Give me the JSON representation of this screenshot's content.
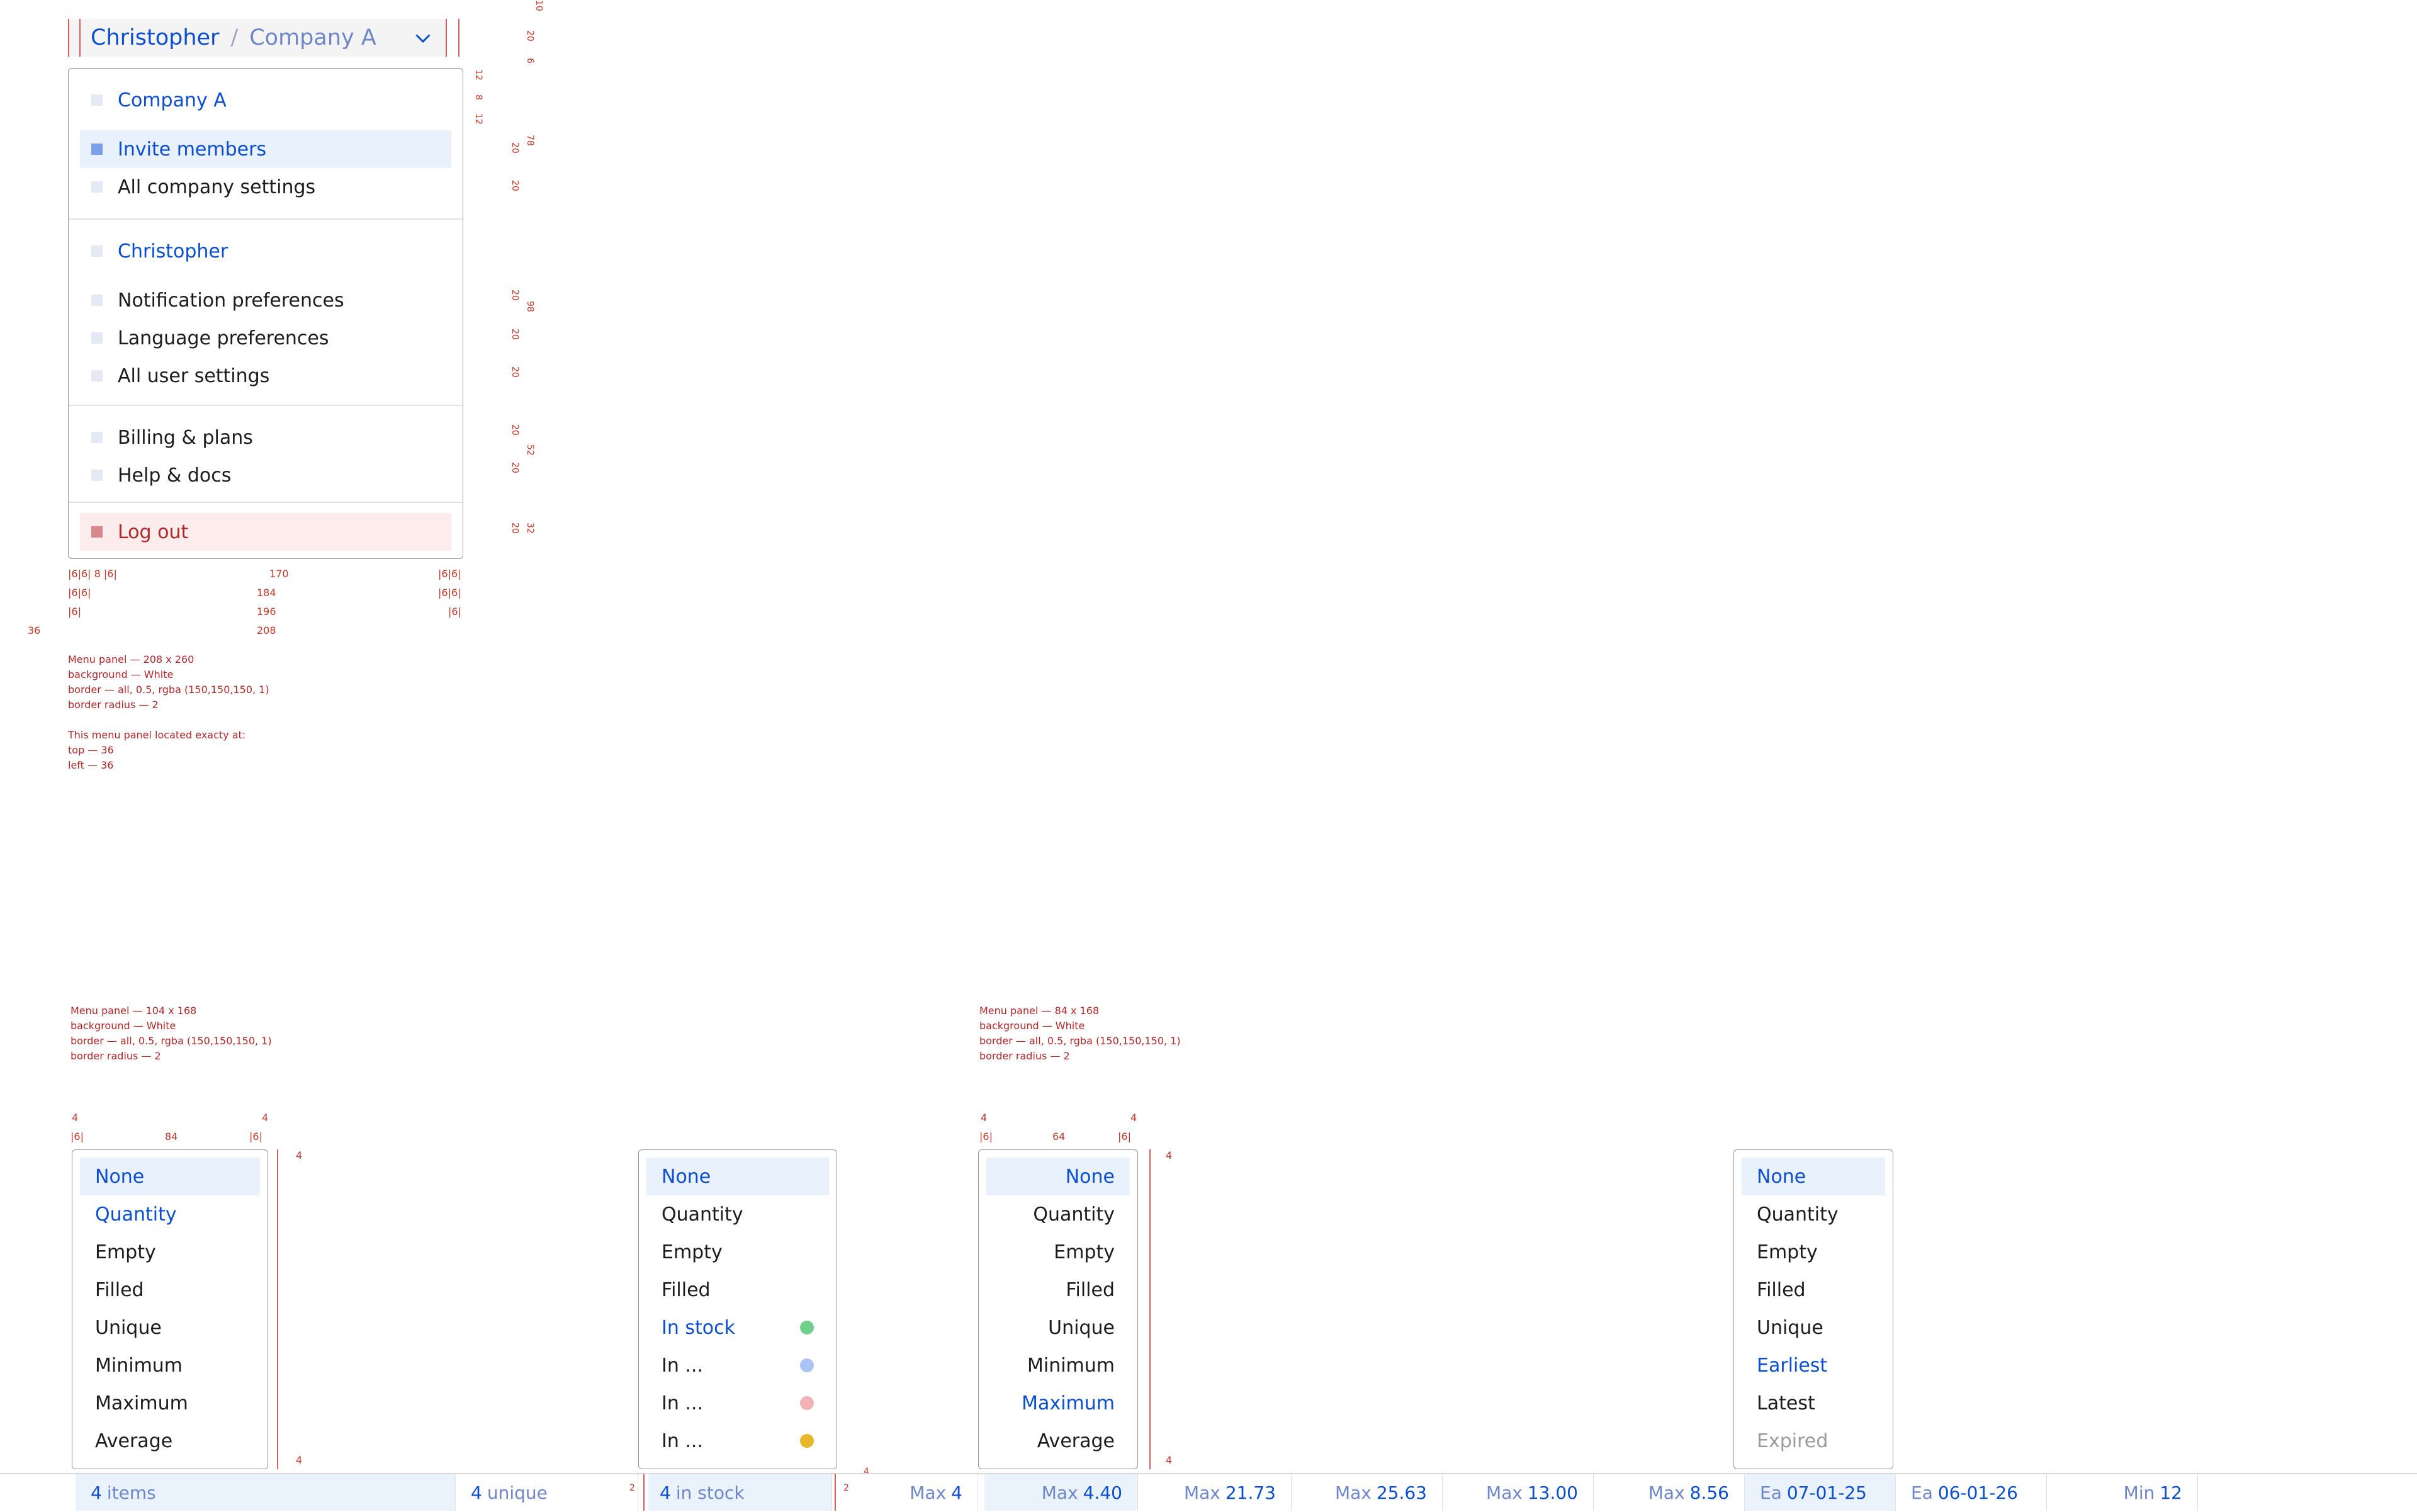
{
  "account": {
    "name": "Christopher",
    "separator": "/",
    "company": "Company A"
  },
  "menu": {
    "company_header": "Company A",
    "invite": "Invite members",
    "company_settings": "All company settings",
    "user_header": "Christopher",
    "notifications": "Notification preferences",
    "language": "Language preferences",
    "user_settings": "All user settings",
    "billing": "Billing & plans",
    "help": "Help & docs",
    "logout": "Log out"
  },
  "annotations": {
    "panel1": [
      "Menu panel — 208 x 260",
      "background — White",
      "border — all, 0.5, rgba (150,150,150, 1)",
      "border radius — 2",
      "",
      "This menu panel located exacty at:",
      "top — 36",
      "left — 36"
    ],
    "panel2": [
      "Menu panel — 104 x 168",
      "background — White",
      "border — all, 0.5, rgba (150,150,150, 1)",
      "border radius — 2"
    ],
    "panel3": [
      "Menu panel — 84 x 168",
      "background — White",
      "border — all, 0.5, rgba (150,150,150, 1)",
      "border radius — 2"
    ],
    "widths_main": [
      "|6|6| 8 |6|",
      "170",
      "|6|6|",
      "|6|6|",
      "184",
      "|6|6|",
      "|6|",
      "196",
      "|6|",
      "208",
      "36"
    ],
    "heights_right": [
      "10",
      "20",
      "6",
      "12",
      "8",
      "12",
      "78",
      "20",
      "20",
      "98",
      "20",
      "20",
      "20",
      "52",
      "20",
      "20",
      "32",
      "20"
    ],
    "small_widths": [
      "4",
      "|6|",
      "84",
      "|6|",
      "4",
      "4",
      "|6|",
      "64",
      "|6|",
      "4"
    ],
    "small_heights": [
      "4",
      "4",
      "4",
      "4",
      "2",
      "2",
      "4"
    ]
  },
  "dropdown1": {
    "items": [
      "None",
      "Quantity",
      "Empty",
      "Filled",
      "Unique",
      "Minimum",
      "Maximum",
      "Average"
    ]
  },
  "dropdown2": {
    "items": [
      "None",
      "Quantity",
      "Empty",
      "Filled",
      "In stock",
      "In ...",
      "In ...",
      "In ..."
    ],
    "dot_colors": [
      "#6fd08c",
      "#a9c4f5",
      "#f3b1b7",
      "#e9b72a"
    ]
  },
  "dropdown3": {
    "items": [
      "None",
      "Quantity",
      "Empty",
      "Filled",
      "Unique",
      "Minimum",
      "Maximum",
      "Average"
    ]
  },
  "dropdown4": {
    "items": [
      "None",
      "Quantity",
      "Empty",
      "Filled",
      "Unique",
      "Earliest",
      "Latest",
      "Expired"
    ]
  },
  "footer": {
    "c1_v": "4",
    "c1_k": "items",
    "c2_v": "4",
    "c2_k": "unique",
    "c3_v": "4",
    "c3_k": "in stock",
    "c4_k": "Max",
    "c4_v": "4",
    "c5_k": "Max",
    "c5_v": "4.40",
    "c6_k": "Max",
    "c6_v": "21.73",
    "c7_k": "Max",
    "c7_v": "25.63",
    "c8_k": "Max",
    "c8_v": "13.00",
    "c9_k": "Max",
    "c9_v": "8.56",
    "c10_k": "Ea",
    "c10_v": "07-01-25",
    "c11_k": "Ea",
    "c11_v": "06-01-26",
    "c12_k": "Min",
    "c12_v": "12"
  },
  "colors": {
    "accent": "#0b4fd0",
    "highlight": "#e8f1fc",
    "logout_bg": "#fdecec",
    "annotation": "#b12828",
    "border": "#969696"
  }
}
